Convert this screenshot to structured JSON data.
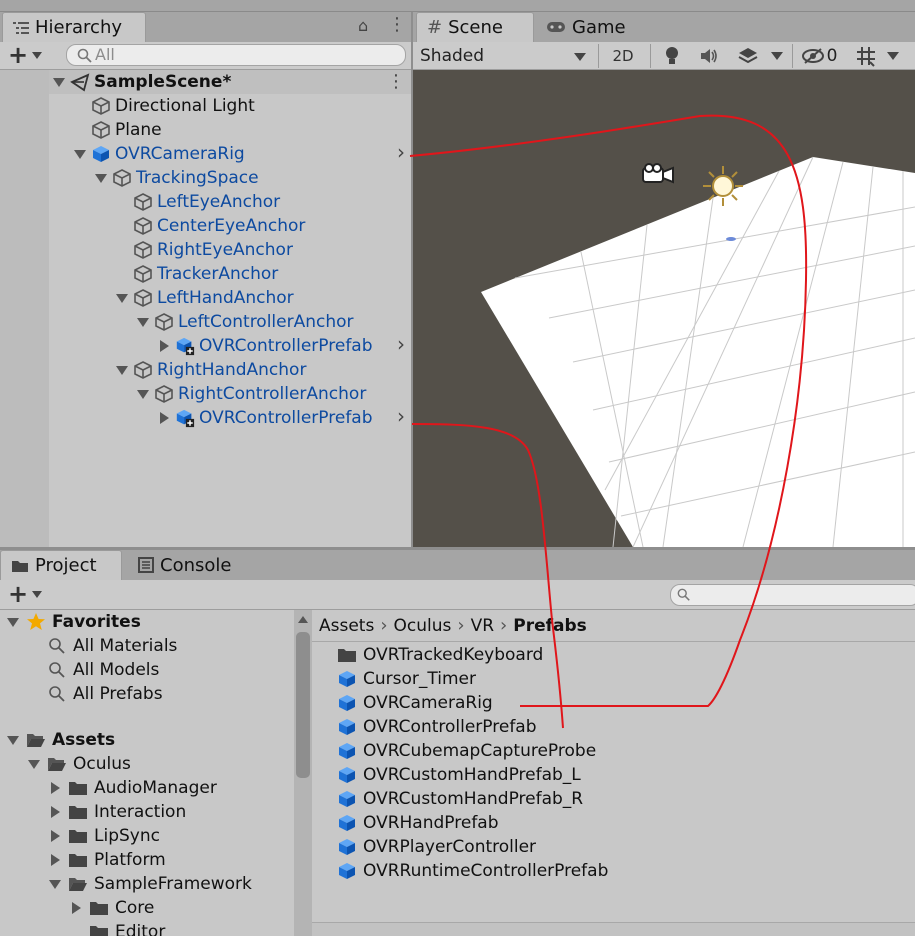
{
  "hierarchy": {
    "tab_label": "Hierarchy",
    "search_placeholder": "All",
    "add_label": "+",
    "rows": [
      {
        "label": "SampleScene*",
        "indent": 0,
        "fold": "down",
        "icon": "unity-scene-icon",
        "bold": true,
        "blue": false,
        "menu": true
      },
      {
        "label": "Directional Light",
        "indent": 1,
        "fold": "none",
        "icon": "gameobject-cube-icon",
        "blue": false
      },
      {
        "label": "Plane",
        "indent": 1,
        "fold": "none",
        "icon": "gameobject-cube-icon",
        "blue": false
      },
      {
        "label": "OVRCameraRig",
        "indent": 1,
        "fold": "down",
        "icon": "prefab-cube-icon",
        "blue": true,
        "arrow": true
      },
      {
        "label": "TrackingSpace",
        "indent": 2,
        "fold": "down",
        "icon": "gameobject-cube-icon",
        "blue": true
      },
      {
        "label": "LeftEyeAnchor",
        "indent": 3,
        "fold": "none",
        "icon": "gameobject-cube-icon",
        "blue": true
      },
      {
        "label": "CenterEyeAnchor",
        "indent": 3,
        "fold": "none",
        "icon": "gameobject-cube-icon",
        "blue": true
      },
      {
        "label": "RightEyeAnchor",
        "indent": 3,
        "fold": "none",
        "icon": "gameobject-cube-icon",
        "blue": true
      },
      {
        "label": "TrackerAnchor",
        "indent": 3,
        "fold": "none",
        "icon": "gameobject-cube-icon",
        "blue": true
      },
      {
        "label": "LeftHandAnchor",
        "indent": 3,
        "fold": "down",
        "icon": "gameobject-cube-icon",
        "blue": true
      },
      {
        "label": "LeftControllerAnchor",
        "indent": 4,
        "fold": "down",
        "icon": "gameobject-cube-icon",
        "blue": true
      },
      {
        "label": "OVRControllerPrefab",
        "indent": 5,
        "fold": "right",
        "icon": "prefab-added-icon",
        "blue": true,
        "arrow": true
      },
      {
        "label": "RightHandAnchor",
        "indent": 3,
        "fold": "down",
        "icon": "gameobject-cube-icon",
        "blue": true
      },
      {
        "label": "RightControllerAnchor",
        "indent": 4,
        "fold": "down",
        "icon": "gameobject-cube-icon",
        "blue": true
      },
      {
        "label": "OVRControllerPrefab",
        "indent": 5,
        "fold": "right",
        "icon": "prefab-added-icon",
        "blue": true,
        "arrow": true
      }
    ]
  },
  "scene": {
    "tab_scene": "Scene",
    "tab_game": "Game",
    "shading_mode": "Shaded",
    "btn_2d": "2D",
    "hidden_count": "0"
  },
  "project": {
    "tab_project": "Project",
    "tab_console": "Console",
    "add_label": "+",
    "tree": [
      {
        "label": "Favorites",
        "indent": 0,
        "fold": "down",
        "icon": "star-icon",
        "bold": true
      },
      {
        "label": "All Materials",
        "indent": 1,
        "fold": "none",
        "icon": "search-icon"
      },
      {
        "label": "All Models",
        "indent": 1,
        "fold": "none",
        "icon": "search-icon"
      },
      {
        "label": "All Prefabs",
        "indent": 1,
        "fold": "none",
        "icon": "search-icon"
      },
      {
        "label": "Assets",
        "indent": 0,
        "fold": "down",
        "icon": "folder-open-icon",
        "bold": true,
        "gap": true
      },
      {
        "label": "Oculus",
        "indent": 1,
        "fold": "down",
        "icon": "folder-open-icon"
      },
      {
        "label": "AudioManager",
        "indent": 2,
        "fold": "right",
        "icon": "folder-icon"
      },
      {
        "label": "Interaction",
        "indent": 2,
        "fold": "right",
        "icon": "folder-icon"
      },
      {
        "label": "LipSync",
        "indent": 2,
        "fold": "right",
        "icon": "folder-icon"
      },
      {
        "label": "Platform",
        "indent": 2,
        "fold": "right",
        "icon": "folder-icon"
      },
      {
        "label": "SampleFramework",
        "indent": 2,
        "fold": "down",
        "icon": "folder-open-icon"
      },
      {
        "label": "Core",
        "indent": 3,
        "fold": "right",
        "icon": "folder-icon"
      },
      {
        "label": "Editor",
        "indent": 3,
        "fold": "none",
        "icon": "folder-icon"
      }
    ],
    "breadcrumb": [
      "Assets",
      "Oculus",
      "VR",
      "Prefabs"
    ],
    "files": [
      {
        "label": "OVRTrackedKeyboard",
        "icon": "folder-icon"
      },
      {
        "label": "Cursor_Timer",
        "icon": "prefab-cube-icon"
      },
      {
        "label": "OVRCameraRig",
        "icon": "prefab-cube-icon"
      },
      {
        "label": "OVRControllerPrefab",
        "icon": "prefab-cube-icon"
      },
      {
        "label": "OVRCubemapCaptureProbe",
        "icon": "prefab-cube-icon"
      },
      {
        "label": "OVRCustomHandPrefab_L",
        "icon": "prefab-cube-icon"
      },
      {
        "label": "OVRCustomHandPrefab_R",
        "icon": "prefab-cube-icon"
      },
      {
        "label": "OVRHandPrefab",
        "icon": "prefab-cube-icon"
      },
      {
        "label": "OVRPlayerController",
        "icon": "prefab-cube-icon"
      },
      {
        "label": "OVRRuntimeControllerPrefab",
        "icon": "prefab-cube-icon"
      }
    ]
  },
  "colors": {
    "prefab_blue": "#0d4aa0",
    "annotation_red": "#e0161b",
    "scene_bg": "#545049"
  }
}
